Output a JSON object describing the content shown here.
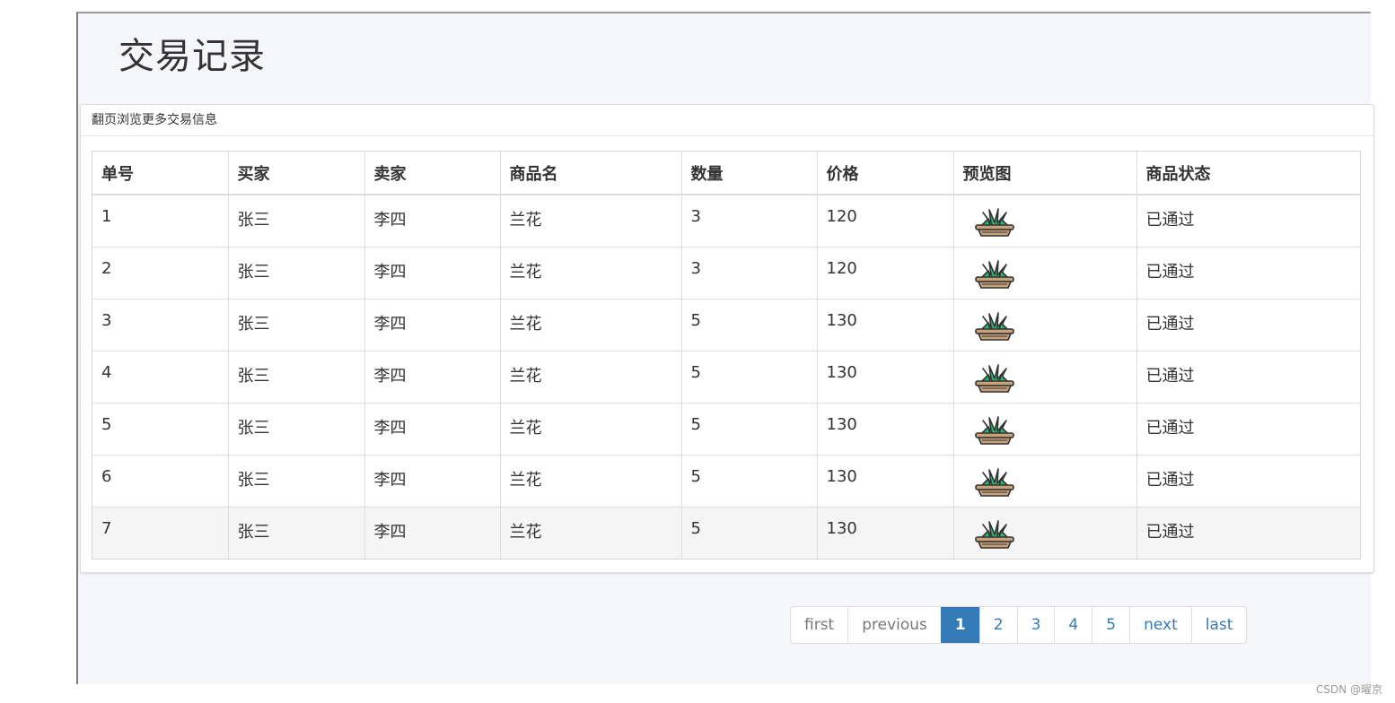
{
  "page": {
    "title": "交易记录",
    "panel_heading": "翻页浏览更多交易信息"
  },
  "table": {
    "headers": [
      "单号",
      "买家",
      "卖家",
      "商品名",
      "数量",
      "价格",
      "预览图",
      "商品状态"
    ],
    "rows": [
      {
        "id": "1",
        "buyer": "张三",
        "seller": "李四",
        "product": "兰花",
        "qty": "3",
        "price": "120",
        "preview": "potted-plant-icon",
        "status": "已通过"
      },
      {
        "id": "2",
        "buyer": "张三",
        "seller": "李四",
        "product": "兰花",
        "qty": "3",
        "price": "120",
        "preview": "potted-plant-icon",
        "status": "已通过"
      },
      {
        "id": "3",
        "buyer": "张三",
        "seller": "李四",
        "product": "兰花",
        "qty": "5",
        "price": "130",
        "preview": "potted-plant-icon",
        "status": "已通过"
      },
      {
        "id": "4",
        "buyer": "张三",
        "seller": "李四",
        "product": "兰花",
        "qty": "5",
        "price": "130",
        "preview": "potted-plant-icon",
        "status": "已通过"
      },
      {
        "id": "5",
        "buyer": "张三",
        "seller": "李四",
        "product": "兰花",
        "qty": "5",
        "price": "130",
        "preview": "potted-plant-icon",
        "status": "已通过"
      },
      {
        "id": "6",
        "buyer": "张三",
        "seller": "李四",
        "product": "兰花",
        "qty": "5",
        "price": "130",
        "preview": "potted-plant-icon",
        "status": "已通过"
      },
      {
        "id": "7",
        "buyer": "张三",
        "seller": "李四",
        "product": "兰花",
        "qty": "5",
        "price": "130",
        "preview": "potted-plant-icon",
        "status": "已通过"
      }
    ]
  },
  "pagination": {
    "first": "first",
    "previous": "previous",
    "pages": [
      "1",
      "2",
      "3",
      "4",
      "5"
    ],
    "active_page": "1",
    "next": "next",
    "last": "last"
  },
  "watermark": "CSDN @曜京",
  "colors": {
    "accent": "#337ab7",
    "plant_leaf": "#2bb673",
    "plant_pot": "#c8a27a"
  }
}
